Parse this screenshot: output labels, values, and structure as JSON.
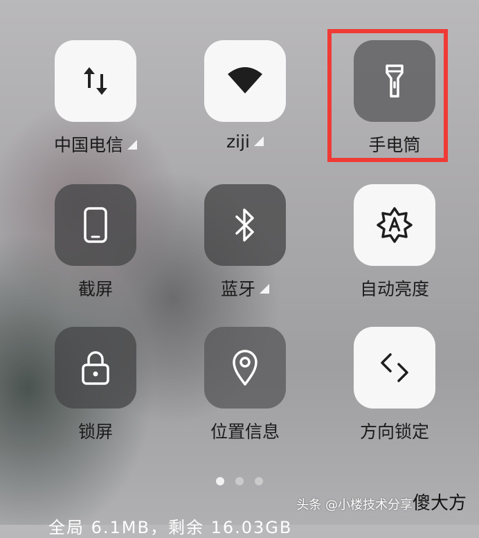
{
  "tiles": [
    {
      "label": "中国电信",
      "icon": "mobile-data-icon",
      "state": "on",
      "has_signal": true
    },
    {
      "label": "ziji",
      "icon": "wifi-icon",
      "state": "on",
      "has_signal": true
    },
    {
      "label": "手电筒",
      "icon": "flashlight-icon",
      "state": "off",
      "highlighted": true
    },
    {
      "label": "截屏",
      "icon": "phone-screenshot-icon",
      "state": "off"
    },
    {
      "label": "蓝牙",
      "icon": "bluetooth-icon",
      "state": "off",
      "has_signal": true
    },
    {
      "label": "自动亮度",
      "icon": "auto-brightness-icon",
      "state": "on"
    },
    {
      "label": "锁屏",
      "icon": "lock-icon",
      "state": "off"
    },
    {
      "label": "位置信息",
      "icon": "location-pin-icon",
      "state": "off"
    },
    {
      "label": "方向锁定",
      "icon": "rotation-lock-icon",
      "state": "on"
    }
  ],
  "pager": {
    "total": 3,
    "active": 1
  },
  "footer": {
    "text": "全局 6.1MB，剩余 16.03GB"
  },
  "watermark": {
    "text": "头条 @小楼技术分享",
    "logo": "傻大方"
  },
  "colors": {
    "highlight": "#f03a35",
    "tile_on": "#f7f7f7",
    "tile_off": "#5a5a5c"
  }
}
